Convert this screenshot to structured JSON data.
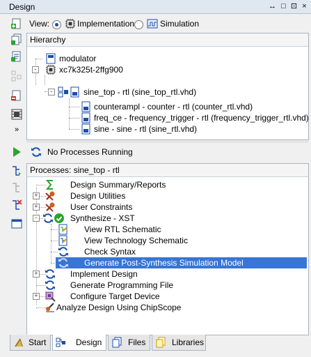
{
  "window": {
    "title": "Design",
    "controls": [
      "↔",
      "□",
      "⊡",
      "×"
    ]
  },
  "view": {
    "label": "View:",
    "options": [
      "Implementation",
      "Simulation"
    ],
    "selected": "Implementation"
  },
  "hierarchy": {
    "header": "Hierarchy",
    "items": [
      {
        "label": "modulator"
      },
      {
        "label": "xc7k325t-2ffg900"
      },
      {
        "label": "sine_top - rtl (sine_top_rtl.vhd)"
      },
      {
        "label": "counterampl - counter - rtl (counter_rtl.vhd)"
      },
      {
        "label": "freq_ce - frequency_trigger - rtl (frequency_trigger_rtl.vhd)"
      },
      {
        "label": "sine - sine - rtl (sine_rtl.vhd)"
      }
    ]
  },
  "status": {
    "text": "No Processes Running"
  },
  "processes": {
    "header": "Processes: sine_top - rtl",
    "items": [
      {
        "label": "Design Summary/Reports"
      },
      {
        "label": "Design Utilities"
      },
      {
        "label": "User Constraints"
      },
      {
        "label": "Synthesize - XST"
      },
      {
        "label": "View RTL Schematic"
      },
      {
        "label": "View Technology Schematic"
      },
      {
        "label": "Check Syntax"
      },
      {
        "label": "Generate Post-Synthesis Simulation Model"
      },
      {
        "label": "Implement Design"
      },
      {
        "label": "Generate Programming File"
      },
      {
        "label": "Configure Target Device"
      },
      {
        "label": "Analyze Design Using ChipScope"
      }
    ]
  },
  "tabs": [
    {
      "label": "Start"
    },
    {
      "label": "Design"
    },
    {
      "label": "Files"
    },
    {
      "label": "Libraries"
    }
  ],
  "active_tab": "Design",
  "colors": {
    "selection": "#3875d7",
    "accent": "#1d4ea8",
    "success": "#2aa52a"
  }
}
